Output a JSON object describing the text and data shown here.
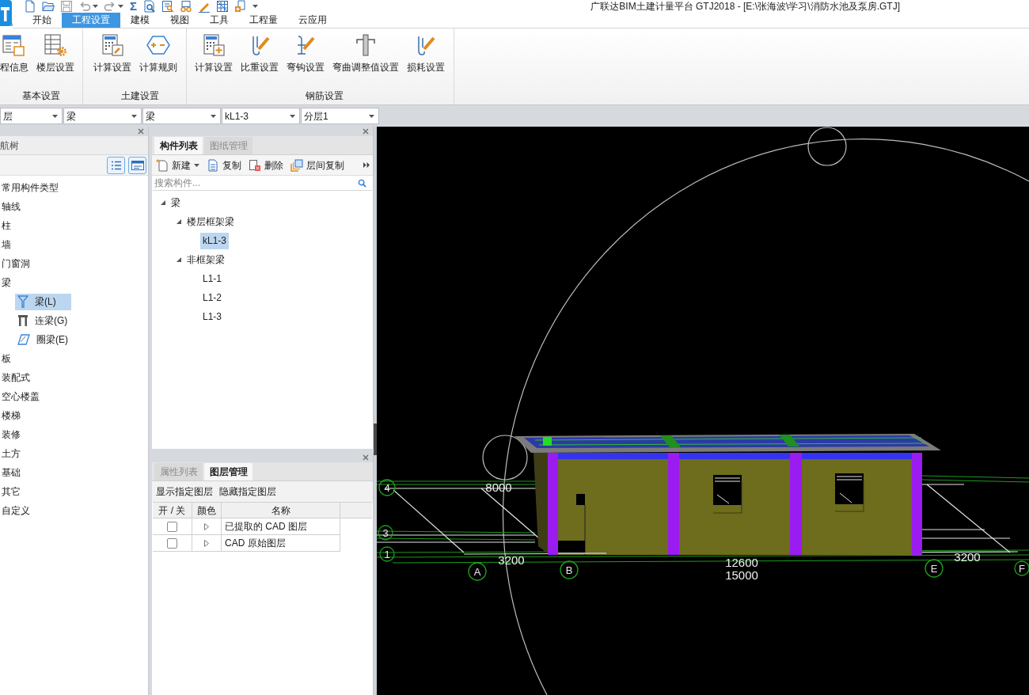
{
  "window": {
    "title": "广联达BIM土建计量平台 GTJ2018 - [E:\\张海波\\学习\\消防水池及泵房.GTJ]"
  },
  "quick_access": {
    "sum_symbol": "Σ"
  },
  "ribbon_tabs": [
    {
      "label": "开始",
      "selected": false
    },
    {
      "label": "工程设置",
      "selected": true
    },
    {
      "label": "建模",
      "selected": false
    },
    {
      "label": "视图",
      "selected": false
    },
    {
      "label": "工具",
      "selected": false
    },
    {
      "label": "工程量",
      "selected": false
    },
    {
      "label": "云应用",
      "selected": false
    }
  ],
  "ribbon_groups": [
    {
      "label": "基本设置",
      "buttons": [
        {
          "label": "程信息"
        },
        {
          "label": "楼层设置"
        }
      ]
    },
    {
      "label": "土建设置",
      "buttons": [
        {
          "label": "计算设置"
        },
        {
          "label": "计算规则"
        }
      ]
    },
    {
      "label": "钢筋设置",
      "buttons": [
        {
          "label": "计算设置"
        },
        {
          "label": "比重设置"
        },
        {
          "label": "弯钩设置"
        },
        {
          "label": "弯曲调整值设置"
        },
        {
          "label": "损耗设置"
        }
      ]
    }
  ],
  "selectors": [
    {
      "value": "层"
    },
    {
      "value": "梁"
    },
    {
      "value": "梁"
    },
    {
      "value": "kL1-3"
    },
    {
      "value": "分层1"
    }
  ],
  "navigation_panel": {
    "title": "航树",
    "items": [
      {
        "label": "常用构件类型",
        "selected": false
      },
      {
        "label": "轴线",
        "selected": false
      },
      {
        "label": "柱",
        "selected": false
      },
      {
        "label": "墙",
        "selected": false
      },
      {
        "label": "门窗洞",
        "selected": false
      },
      {
        "label": "梁",
        "selected": false,
        "children": [
          {
            "label": "梁(L)",
            "selected": true
          },
          {
            "label": "连梁(G)",
            "selected": false
          },
          {
            "label": "圈梁(E)",
            "selected": false
          }
        ]
      },
      {
        "label": "板",
        "selected": false
      },
      {
        "label": "装配式",
        "selected": false
      },
      {
        "label": "空心楼盖",
        "selected": false
      },
      {
        "label": "楼梯",
        "selected": false
      },
      {
        "label": "装修",
        "selected": false
      },
      {
        "label": "土方",
        "selected": false
      },
      {
        "label": "基础",
        "selected": false
      },
      {
        "label": "其它",
        "selected": false
      },
      {
        "label": "自定义",
        "selected": false
      }
    ]
  },
  "component_panel": {
    "tabs": [
      {
        "label": "构件列表",
        "selected": true
      },
      {
        "label": "图纸管理",
        "selected": false
      }
    ],
    "toolbar": [
      {
        "label": "新建",
        "menu": true
      },
      {
        "label": "复制",
        "menu": false
      },
      {
        "label": "删除",
        "menu": false
      },
      {
        "label": "层间复制",
        "menu": false
      }
    ],
    "search": {
      "placeholder": "搜索构件..."
    },
    "tree": [
      {
        "label": "梁",
        "selected": false,
        "expanded": true,
        "children": [
          {
            "label": "楼层框架梁",
            "selected": false,
            "expanded": true,
            "children": [
              {
                "label": "kL1-3",
                "selected": true
              }
            ]
          },
          {
            "label": "非框架梁",
            "selected": false,
            "expanded": true,
            "children": [
              {
                "label": "L1-1",
                "selected": false
              },
              {
                "label": "L1-2",
                "selected": false
              },
              {
                "label": "L1-3",
                "selected": false
              }
            ]
          }
        ]
      }
    ]
  },
  "layer_panel": {
    "tabs": [
      {
        "label": "属性列表",
        "selected": false
      },
      {
        "label": "图层管理",
        "selected": true
      }
    ],
    "actions": [
      "显示指定图层",
      "隐藏指定图层"
    ],
    "columns": [
      "开 / 关",
      "颜色",
      "名称"
    ],
    "rows": [
      {
        "checked": false,
        "expanded": false,
        "name": "已提取的 CAD 图层"
      },
      {
        "checked": false,
        "expanded": false,
        "name": "CAD 原始图层"
      }
    ]
  },
  "viewport": {
    "dimension_labels": [
      "8000",
      "3200",
      "12600",
      "15000",
      "3200"
    ],
    "axis_labels": [
      "A",
      "B",
      "E",
      "F",
      "4",
      "3",
      "1"
    ]
  }
}
